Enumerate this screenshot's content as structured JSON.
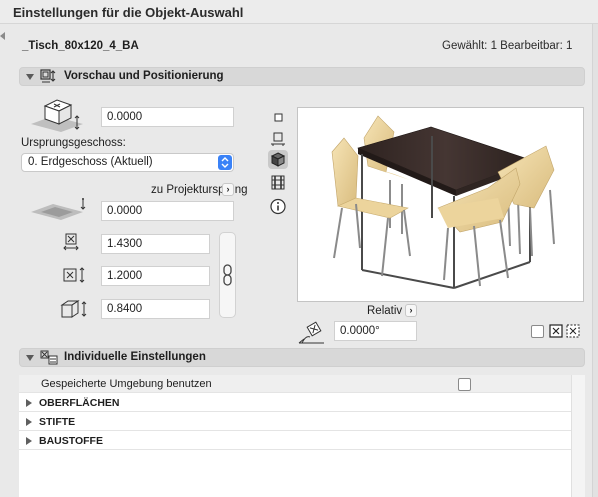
{
  "window": {
    "title": "Einstellungen für die Objekt-Auswahl"
  },
  "header": {
    "object_name": "_Tisch_80x120_4_BA",
    "selection_info": "Gewählt: 1 Bearbeitbar: 1"
  },
  "section_preview": {
    "title": "Vorschau und Positionierung",
    "icon": "preview-position-icon",
    "elevation_value": "0.0000",
    "origin_story_label": "Ursprungsgeschoss:",
    "origin_story_value": "0. Erdgeschoss (Aktuell)",
    "project_origin_label": "zu Projektursprung",
    "project_origin_value": "0.0000",
    "width_value": "1.4300",
    "depth_value": "1.2000",
    "height_value": "0.8400",
    "relative_label": "Relativ",
    "angle_value": "0.0000°"
  },
  "view_modes": [
    {
      "name": "2d-symbol-icon"
    },
    {
      "name": "plan-symbol-icon"
    },
    {
      "name": "3d-view-icon",
      "active": true
    },
    {
      "name": "section-icon"
    },
    {
      "name": "info-icon"
    }
  ],
  "section_individual": {
    "title": "Individuelle Einstellungen",
    "icon": "individual-settings-icon",
    "saved_env_label": "Gespeicherte Umgebung benutzen",
    "rows": [
      {
        "label": "OBERFLÄCHEN"
      },
      {
        "label": "STIFTE"
      },
      {
        "label": "BAUSTOFFE"
      }
    ]
  },
  "colors": {
    "accent": "#3a82f7",
    "section_bg": "#d8d8d8",
    "table_wood": "#3b2f2c",
    "chair": "#f0d9a4"
  }
}
